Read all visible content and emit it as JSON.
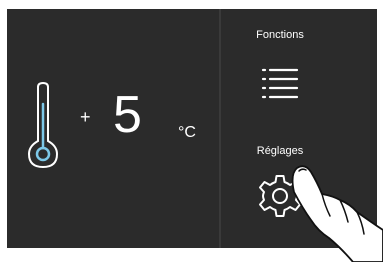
{
  "temperature": {
    "sign": "+",
    "value": "5",
    "unit": "°C"
  },
  "sidebar": {
    "functions_label": "Fonctions",
    "settings_label": "Réglages"
  },
  "icons": {
    "thermometer": "thermometer-icon",
    "menu": "menu-icon",
    "settings": "gear-icon",
    "pointer": "hand-pointer"
  },
  "colors": {
    "panel_background": "#2b2b2b",
    "text": "#ffffff",
    "thermometer_fill": "#7dc8e8"
  }
}
